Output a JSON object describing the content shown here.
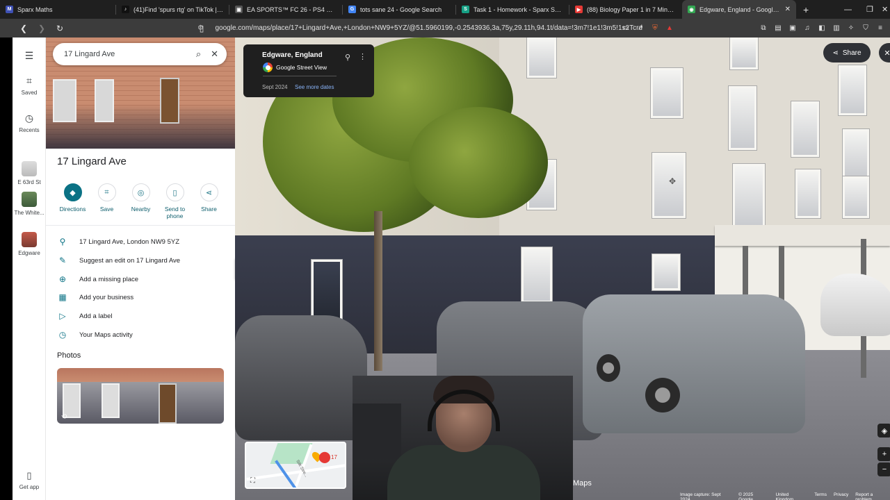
{
  "browser": {
    "tabs": [
      {
        "label": "Sparx Maths",
        "fav": "M",
        "color": "#3f51b5",
        "active": false
      },
      {
        "label": "(41)Find 'spurs rtg' on TikTok | TikTok",
        "fav": "♪",
        "color": "#111111",
        "active": false
      },
      {
        "label": "EA SPORTS™ FC 26 - PS4 & PS5 Gam",
        "fav": "▣",
        "color": "#555555",
        "active": false
      },
      {
        "label": "tots sane 24 - Google Search",
        "fav": "G",
        "color": "#4285f4",
        "active": false
      },
      {
        "label": "Task 1 - Homework - Sparx Science",
        "fav": "S",
        "color": "#16a085",
        "active": false
      },
      {
        "label": "(88) Biology Paper 1 in 7 Minutes! | E",
        "fav": "▶",
        "color": "#e53935",
        "active": false
      },
      {
        "label": "Edgware, England - Google Maps",
        "fav": "◉",
        "color": "#34a853",
        "active": true
      }
    ],
    "url": "google.com/maps/place/17+Lingard+Ave,+London+NW9+5YZ/@51.5960199,-0.2543936,3a,75y,29.11h,94.1t/data=!3m7!1e1!3m5!1s2TcrdGyB..."
  },
  "rail": {
    "saved": "Saved",
    "recents": "Recents",
    "recent_items": [
      {
        "label": "E 63rd St"
      },
      {
        "label": "The White..."
      },
      {
        "label": "Edgware"
      }
    ],
    "get_app": "Get app"
  },
  "search": {
    "value": "17 Lingard Ave"
  },
  "place": {
    "title": "17 Lingard Ave",
    "actions": {
      "directions": "Directions",
      "save": "Save",
      "nearby": "Nearby",
      "send_to_phone": "Send to phone",
      "share": "Share"
    },
    "info": {
      "address": "17 Lingard Ave, London NW9 5YZ",
      "suggest_edit": "Suggest an edit on 17 Lingard Ave",
      "add_missing": "Add a missing place",
      "add_business": "Add your business",
      "add_label": "Add a label",
      "maps_activity": "Your Maps activity"
    },
    "photos_heading": "Photos"
  },
  "streetview": {
    "location": "Edgware, England",
    "source": "Google Street View",
    "date": "Sept 2024",
    "see_more": "See more dates",
    "share": "Share",
    "minimap_label": "17",
    "minimap_street": "Silk Stre...",
    "watermark": "Maps"
  },
  "footer": {
    "capture": "Image capture: Sept 2024",
    "copyright": "© 2025 Google",
    "region": "United Kingdom",
    "terms": "Terms",
    "privacy": "Privacy",
    "report": "Report a problem"
  }
}
